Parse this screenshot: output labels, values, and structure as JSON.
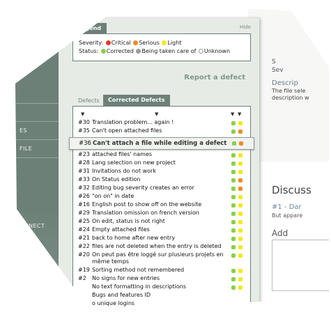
{
  "nav": {
    "items": [
      "ES",
      "FILE",
      "ONNECT"
    ]
  },
  "legend": {
    "tab_label": "Legend",
    "hide_label": "Hide",
    "severity_label": "Severity:",
    "severity": [
      {
        "label": "Critical",
        "color": "#e53a1e"
      },
      {
        "label": "Serious",
        "color": "#f08a24"
      },
      {
        "label": "Light",
        "color": "#f2ea1a"
      }
    ],
    "status_label": "Status:",
    "status": [
      {
        "label": "Corrected",
        "color": "#8ccf4a"
      },
      {
        "label": "Being taken care of",
        "color": "#9a9a9a"
      },
      {
        "label": "Unknown",
        "color": "#ffffff"
      }
    ]
  },
  "report_link": "Report a defect",
  "tabs": {
    "defects": "Defects",
    "corrected": "Corrected Defects"
  },
  "defects": [
    {
      "id": "#30",
      "title": "Translation problem... again !",
      "status": "#8ccf4a",
      "severity": "#f2ea1a"
    },
    {
      "id": "#35",
      "title": "Can't open attached files",
      "status": "#8ccf4a",
      "severity": "#f08a24"
    },
    {
      "id": "#36",
      "title": "Can't attach a file while editing a defect",
      "status": "#8ccf4a",
      "severity": "#f08a24",
      "highlight": true
    },
    {
      "id": "#23",
      "title": "attached files' names",
      "status": "#8ccf4a",
      "severity": "#f2ea1a"
    },
    {
      "id": "#28",
      "title": "Lang selection on new project",
      "status": "#8ccf4a",
      "severity": "#f2ea1a"
    },
    {
      "id": "#31",
      "title": "Invitations do not work",
      "status": "#8ccf4a",
      "severity": "#f2ea1a"
    },
    {
      "id": "#33",
      "title": "On Status edition",
      "status": "#8ccf4a",
      "severity": "#f08a24"
    },
    {
      "id": "#32",
      "title": "Editing bug severity creates an error",
      "status": "#8ccf4a",
      "severity": "#f08a24"
    },
    {
      "id": "#26",
      "title": "\"on on\" in date",
      "status": "#8ccf4a",
      "severity": "#f2ea1a"
    },
    {
      "id": "#16",
      "title": "English post to show off on the website",
      "status": "#8ccf4a",
      "severity": "#f2ea1a"
    },
    {
      "id": "#29",
      "title": "Translation omission on french version",
      "status": "#8ccf4a",
      "severity": "#f2ea1a"
    },
    {
      "id": "#25",
      "title": "On edit, status is not right",
      "status": "#8ccf4a",
      "severity": "#f2ea1a"
    },
    {
      "id": "#24",
      "title": "Empty attached files",
      "status": "#8ccf4a",
      "severity": "#f2ea1a"
    },
    {
      "id": "#21",
      "title": "back to home after new entry",
      "status": "#8ccf4a",
      "severity": "#f2ea1a"
    },
    {
      "id": "#22",
      "title": "files are not deleted when the entry is deleted",
      "status": "#8ccf4a",
      "severity": "#f2ea1a"
    },
    {
      "id": "#20",
      "title": "On peut pas être loggé sur plusieurs projets en même temps",
      "status": "#8ccf4a",
      "severity": "#f2ea1a",
      "two_line": true
    },
    {
      "id": "#19",
      "title": "Sorting method not remembered",
      "status": "#8ccf4a",
      "severity": "#f2ea1a"
    },
    {
      "id": "#2",
      "title": "No signs for new entries",
      "status": "#8ccf4a",
      "severity": "#f2ea1a"
    },
    {
      "id": "",
      "title": "No text formatting in descriptions",
      "status": "#8ccf4a",
      "severity": "#f2ea1a"
    },
    {
      "id": "",
      "title": "Bugs and features ID",
      "status": "",
      "severity": ""
    },
    {
      "id": "",
      "title": "o unique logins",
      "status": "",
      "severity": ""
    }
  ],
  "right_page": {
    "s_letter": "S",
    "sev_label": "Sev",
    "desc_title": "Descrip",
    "desc_line1": "The file sele",
    "desc_line2": "description w",
    "discuss": "Discuss",
    "entry": "#1 - Dar",
    "entry_text": "But appare",
    "add_label": "Add"
  }
}
